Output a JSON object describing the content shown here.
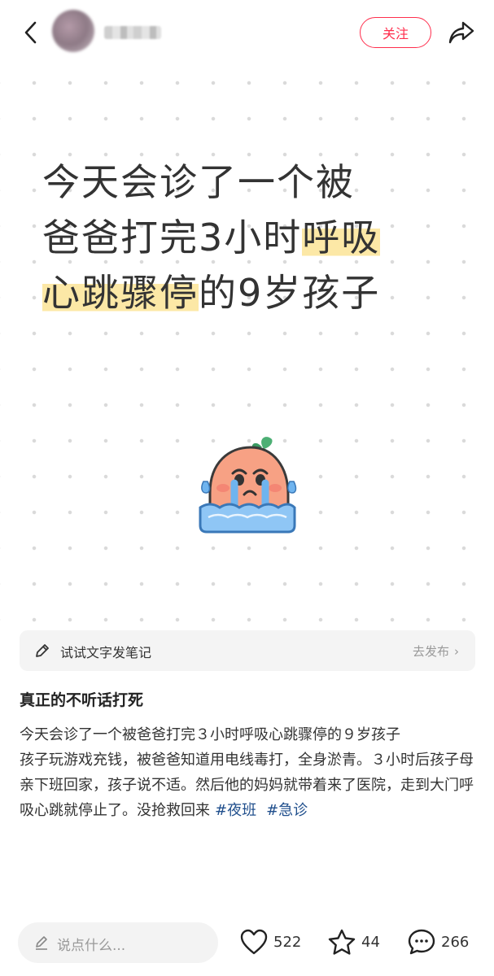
{
  "header": {
    "follow_label": "关注"
  },
  "note_image": {
    "headline_line1": "今天会诊了一个被",
    "headline_line2_plain": "爸爸打完3小时",
    "headline_line2_highlight": "呼吸",
    "headline_line3_highlight": "心跳骤停",
    "headline_line3_plain": "的9岁孩子",
    "emoji_icon": "crying-face-emoji-icon"
  },
  "try_bar": {
    "label": "试试文字发笔记",
    "action": "去发布",
    "chevron": "›"
  },
  "post": {
    "title": "真正的不听话打死",
    "paragraph1": "今天会诊了一个被爸爸打完３小时呼吸心跳骤停的９岁孩子",
    "paragraph2": "孩子玩游戏充钱，被爸爸知道用电线毒打，全身淤青。３小时后孩子母亲下班回家，孩子说不适。然后他的妈妈就带着来了医院，走到大门呼吸心跳就停止了。没抢救回来",
    "tags": [
      "#夜班",
      "#急诊"
    ]
  },
  "bottom_bar": {
    "comment_placeholder": "说点什么...",
    "like_count": "522",
    "star_count": "44",
    "comment_count": "266"
  },
  "colors": {
    "accent": "#ff2e4d",
    "tag": "#1f4e8c",
    "highlight": "#fce8a6"
  }
}
